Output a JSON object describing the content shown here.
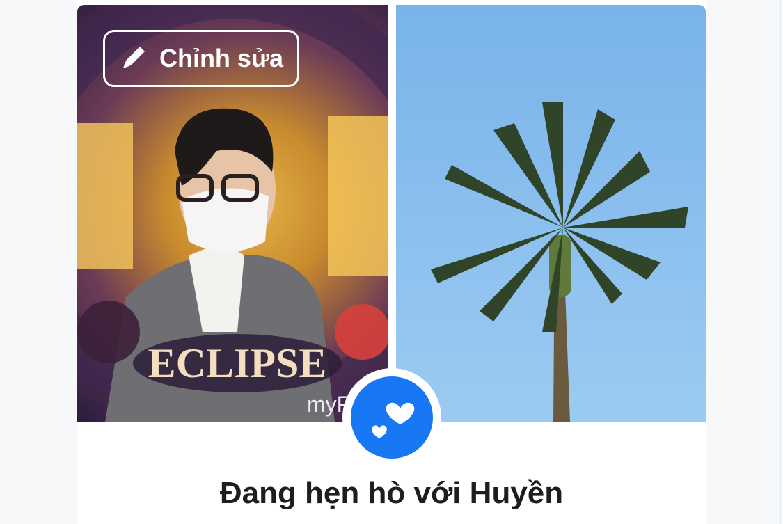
{
  "profiles": {
    "left_photo": {
      "alt": "profile-photo-eclipse"
    },
    "right_photo": {
      "alt": "profile-photo-palm-tree"
    }
  },
  "edit_button": {
    "label": "Chỉnh sửa",
    "icon": "pencil-icon"
  },
  "relationship": {
    "badge_icon": "hearts-icon",
    "status_text": "Đang hẹn hò với Huyền"
  },
  "colors": {
    "accent": "#1877f2",
    "text": "#1c1e21"
  }
}
